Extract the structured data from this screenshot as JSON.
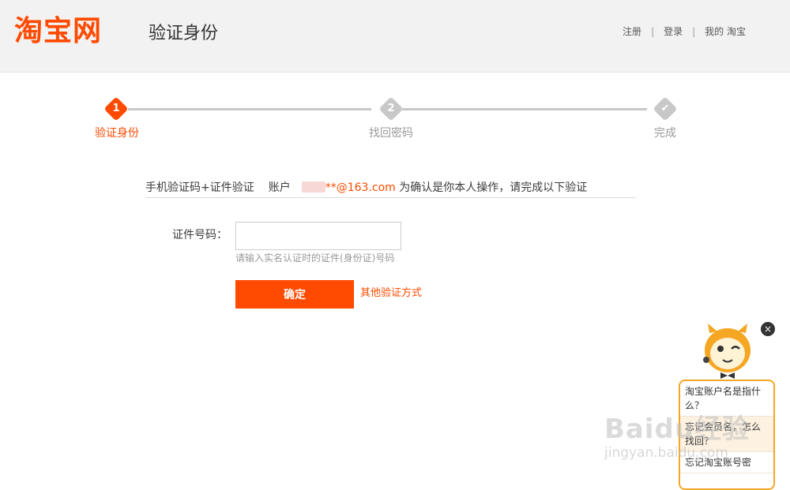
{
  "header": {
    "logo": "淘宝网",
    "page_title": "验证身份",
    "links": [
      "注册",
      "登录",
      "我的 淘宝"
    ]
  },
  "steps": [
    {
      "num": "1",
      "label": "验证身份",
      "state": "active"
    },
    {
      "num": "2",
      "label": "找回密码",
      "state": "pending"
    },
    {
      "num": "✔",
      "label": "完成",
      "state": "pending"
    }
  ],
  "verify": {
    "method": "手机验证码+证件验证",
    "account_label": "账户",
    "email": "**@163.com",
    "instruction": "为确认是你本人操作，请完成以下验证"
  },
  "form": {
    "id_label": "证件号码：",
    "id_value": "",
    "hint": "请输入实名认证时的证件(身份证)号码",
    "confirm_label": "确定",
    "other_link": "其他验证方式"
  },
  "assistant": {
    "close_label": "×",
    "faq": [
      "淘宝账户名是指什么？",
      "忘记会员名，怎么找回？",
      "忘记淘宝账号密"
    ]
  },
  "watermark": {
    "main": "Baidu经验",
    "sub": "jingyan.baidu.com"
  },
  "colors": {
    "accent": "#ff4a00",
    "step_pending": "#c8c8c8",
    "header_bg": "#f2f2f2"
  }
}
